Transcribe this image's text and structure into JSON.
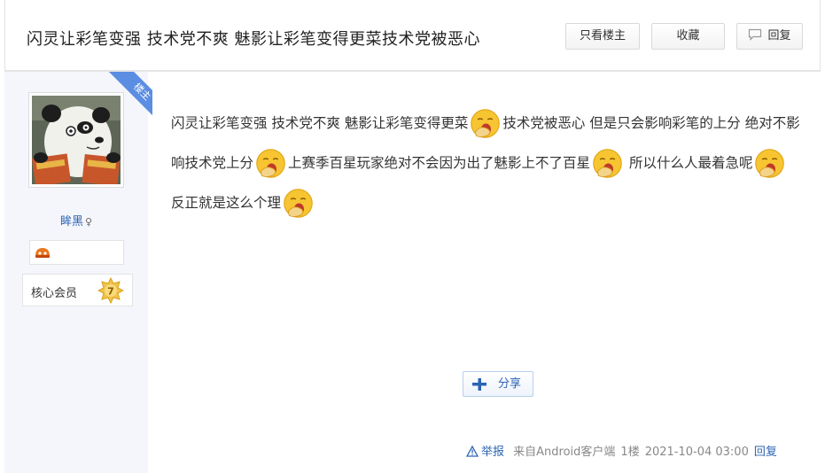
{
  "thread": {
    "title": "闪灵让彩笔变强 技术党不爽 魅影让彩笔变得更菜技术党被恶心",
    "only_op_label": "只看楼主",
    "favorite_label": "收藏",
    "reply_label": "回复"
  },
  "author": {
    "op_tag": "楼主",
    "username": "眸黑",
    "gender_icon": "♀",
    "member_label": "核心会员",
    "level": "7"
  },
  "post": {
    "segments": [
      {
        "type": "text",
        "value": "闪灵让彩笔变强 技术党不爽 魅影让彩笔变得更菜"
      },
      {
        "type": "emoji",
        "name": "yawn-emoji"
      },
      {
        "type": "text",
        "value": "技术党被恶心 但是只会影响彩笔的上分 绝对不影响技术党上分"
      },
      {
        "type": "emoji",
        "name": "yawn-emoji"
      },
      {
        "type": "text",
        "value": "上赛季百星玩家绝对不会因为出了魅影上不了百星"
      },
      {
        "type": "emoji",
        "name": "yawn-emoji"
      },
      {
        "type": "text",
        "value": " 所以什么人最着急呢"
      },
      {
        "type": "emoji",
        "name": "yawn-emoji"
      },
      {
        "type": "text",
        "value": " 反正就是这么个理"
      },
      {
        "type": "emoji",
        "name": "yawn-emoji"
      }
    ],
    "share_label": "分享"
  },
  "footer": {
    "report_label": "举报",
    "source": "来自Android客户端",
    "floor": "1楼",
    "timestamp": "2021-10-04 03:00",
    "reply_label": "回复"
  },
  "colors": {
    "link": "#2d64b3",
    "sidebar_bg": "#f4f6fb",
    "op_tag_bg": "#5b8de2",
    "emoji": "#f7c531"
  }
}
